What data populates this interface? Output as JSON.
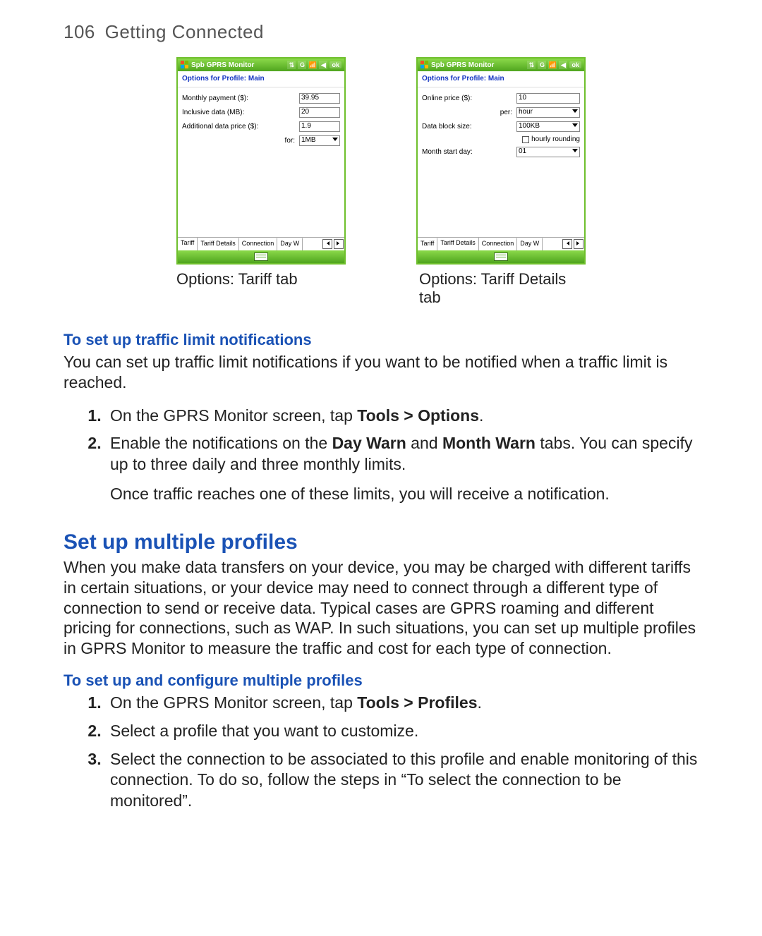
{
  "header": {
    "page_number": "106",
    "section": "Getting Connected"
  },
  "phone_common": {
    "app_title": "Spb GPRS Monitor",
    "ok": "ok",
    "subheader": "Options for Profile: Main",
    "tabs": {
      "t1": "Tariff",
      "t2": "Tariff Details",
      "t3": "Connection",
      "t4": "Day W"
    }
  },
  "phone_left": {
    "monthly_label": "Monthly payment ($):",
    "monthly_value": "39.95",
    "inclusive_label": "Inclusive data (MB):",
    "inclusive_value": "20",
    "additional_label": "Additional data price ($):",
    "additional_value": "1.9",
    "for_label": "for:",
    "for_value": "1MB"
  },
  "phone_right": {
    "online_label": "Online price ($):",
    "online_value": "10",
    "per_label": "per:",
    "per_value": "hour",
    "block_label": "Data block size:",
    "block_value": "100KB",
    "hourly_label": "hourly rounding",
    "monthstart_label": "Month start day:",
    "monthstart_value": "01"
  },
  "captions": {
    "left": "Options: Tariff tab",
    "right": "Options: Tariff Details tab"
  },
  "section1": {
    "heading": "To set up traffic limit notifications",
    "intro": "You can set up traffic limit notifications if you want to be notified when a traffic limit is reached.",
    "step1_a": "On the GPRS Monitor screen, tap ",
    "step1_b": "Tools > Options",
    "step1_c": ".",
    "step2_a": "Enable the notifications on the ",
    "step2_b": "Day Warn",
    "step2_c": " and ",
    "step2_d": "Month Warn",
    "step2_e": " tabs. You can specify up to three daily and three monthly limits.",
    "note": "Once traffic reaches one of these limits, you will receive a notification."
  },
  "section2": {
    "heading": "Set up multiple profiles",
    "intro": "When you make data transfers on your device, you may be charged with different tariffs in certain situations, or your device may need to connect through a different type of connection to send or receive data. Typical cases are GPRS roaming and different pricing for connections, such as WAP. In such situations, you can set up multiple profiles in GPRS Monitor to measure the traffic and cost for each type of connection.",
    "subheading": "To set up and configure multiple profiles",
    "step1_a": "On the GPRS Monitor screen, tap ",
    "step1_b": "Tools > Profiles",
    "step1_c": ".",
    "step2": "Select a profile that you want to customize.",
    "step3": "Select the connection to be associated to this profile and enable monitoring of this connection. To do so, follow the steps in  “To select the connection to be monitored”."
  }
}
